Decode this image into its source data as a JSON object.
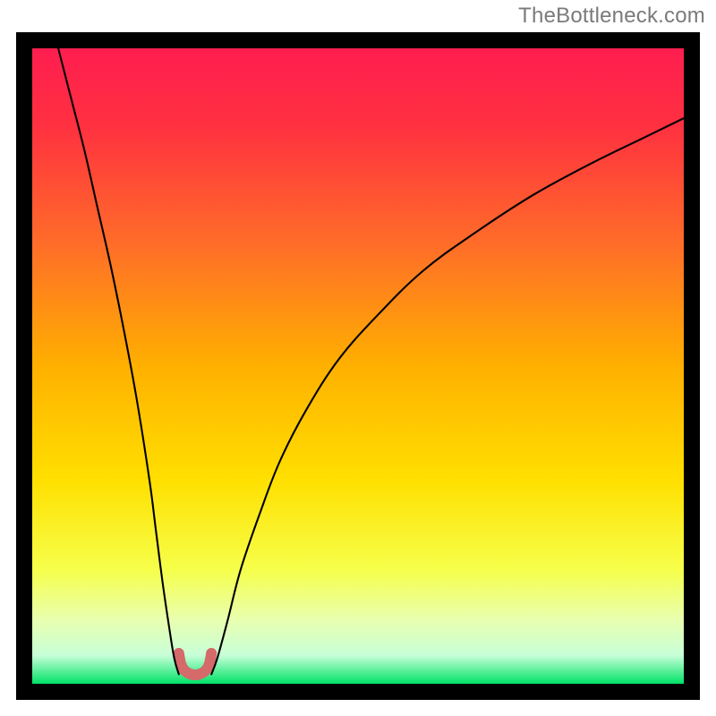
{
  "watermark": "TheBottleneck.com",
  "chart_data": {
    "type": "line",
    "title": "",
    "xlabel": "",
    "ylabel": "",
    "xlim": [
      0,
      100
    ],
    "ylim": [
      0,
      100
    ],
    "grid": false,
    "legend": false,
    "gradient_stops": [
      {
        "offset": 0,
        "color": "#ff1e50"
      },
      {
        "offset": 0.12,
        "color": "#ff3040"
      },
      {
        "offset": 0.3,
        "color": "#ff6a2a"
      },
      {
        "offset": 0.5,
        "color": "#ffb000"
      },
      {
        "offset": 0.68,
        "color": "#ffe000"
      },
      {
        "offset": 0.82,
        "color": "#f6ff4a"
      },
      {
        "offset": 0.9,
        "color": "#e8ffb0"
      },
      {
        "offset": 0.955,
        "color": "#c8ffd8"
      },
      {
        "offset": 1.0,
        "color": "#00e266"
      }
    ],
    "series": [
      {
        "name": "left-branch",
        "x": [
          4,
          6,
          8,
          10,
          12,
          14,
          16,
          18,
          19,
          20,
          21,
          21.8,
          22.5
        ],
        "y": [
          100,
          92,
          84,
          75,
          66,
          56,
          45,
          32,
          24,
          16,
          9,
          4,
          1.5
        ]
      },
      {
        "name": "valley-marker",
        "x": [
          22.5,
          22.8,
          23.3,
          24.1,
          25.0,
          25.9,
          26.7,
          27.2,
          27.5
        ],
        "y": [
          4.8,
          3.2,
          2.2,
          1.6,
          1.4,
          1.6,
          2.2,
          3.2,
          4.8
        ]
      },
      {
        "name": "right-branch",
        "x": [
          27.5,
          28.4,
          30,
          32,
          35,
          38,
          42,
          47,
          53,
          60,
          68,
          77,
          86,
          94,
          100
        ],
        "y": [
          1.5,
          4,
          10,
          18,
          27,
          35,
          43,
          51,
          58,
          65,
          71,
          77,
          82,
          86,
          89
        ]
      }
    ],
    "valley_color": "#d46a6a",
    "valley_width": 12,
    "curve_color": "#000000",
    "curve_width": 2.1
  }
}
